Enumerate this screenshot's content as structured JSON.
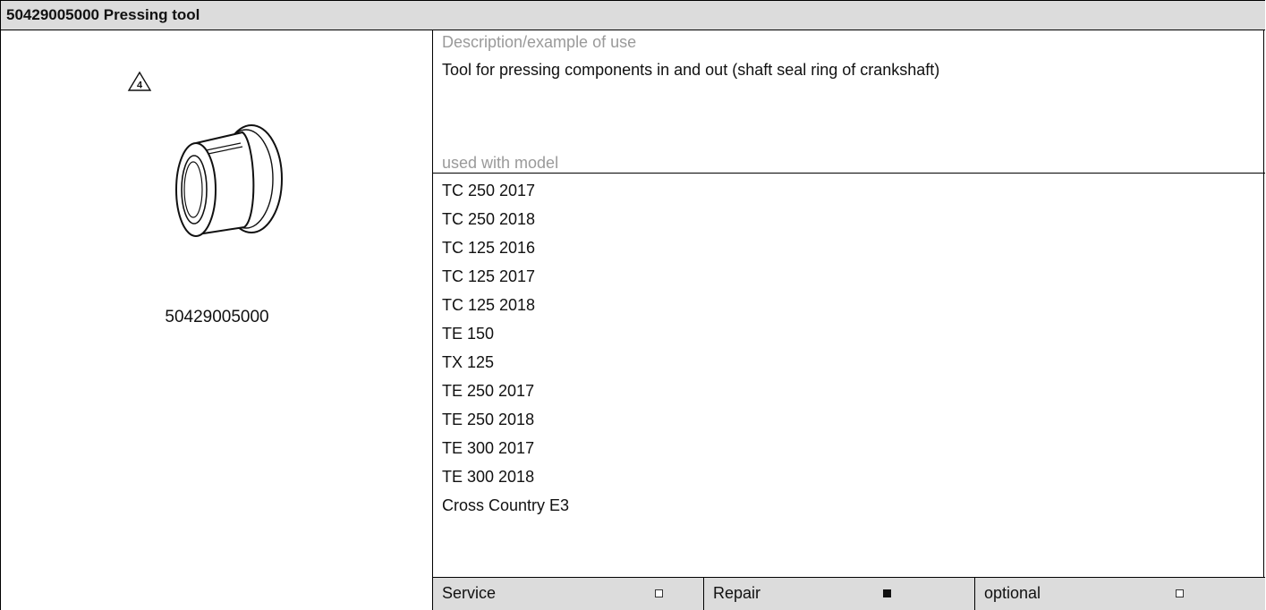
{
  "header": {
    "title": "50429005000 Pressing tool"
  },
  "image": {
    "warning_mark": "4",
    "part_number": "50429005000"
  },
  "description": {
    "label": "Description/example of use",
    "text": "Tool for pressing components in and out (shaft seal ring of crankshaft)"
  },
  "models": {
    "label": "used with model",
    "items": [
      "TC 250 2017",
      "TC 250 2018",
      "TC 125 2016",
      "TC 125 2017",
      "TC 125 2018",
      "TE 150",
      "TX 125",
      "TE 250 2017",
      "TE 250 2018",
      "TE 300 2017",
      "TE 300 2018",
      "Cross Country E3"
    ]
  },
  "usage": [
    {
      "label": "Service",
      "checked": false
    },
    {
      "label": "Repair",
      "checked": true
    },
    {
      "label": "optional",
      "checked": false
    }
  ]
}
